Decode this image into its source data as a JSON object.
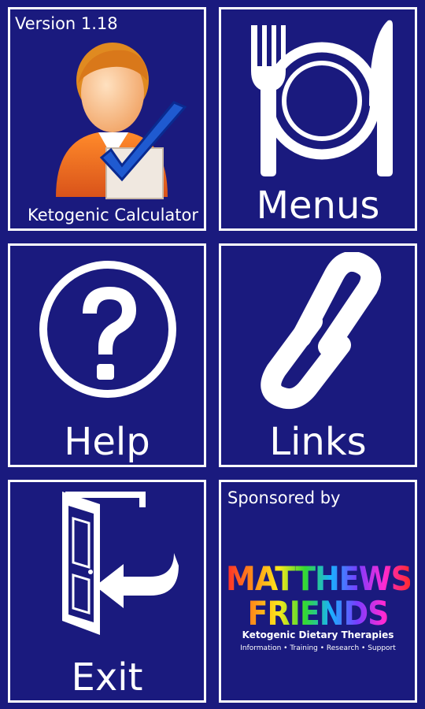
{
  "calculator": {
    "version": "Version 1.18",
    "label": "Ketogenic Calculator"
  },
  "menus": {
    "label": "Menus"
  },
  "help": {
    "label": "Help"
  },
  "links": {
    "label": "Links"
  },
  "exit": {
    "label": "Exit"
  },
  "sponsor": {
    "heading": "Sponsored by",
    "logo_name": "MATTHEWS FRIENDS",
    "logo_subtitle": "Ketogenic Dietary Therapies",
    "logo_tagline": "Information • Training • Research • Support"
  },
  "colors": {
    "background": "#1a1a7e",
    "tile_border": "#ffffff",
    "icon": "#ffffff"
  },
  "icons": {
    "calculator": "user-checkmark-icon",
    "menus": "plate-fork-knife-icon",
    "help": "question-mark-circle-icon",
    "links": "chain-link-icon",
    "exit": "door-exit-arrow-icon"
  }
}
